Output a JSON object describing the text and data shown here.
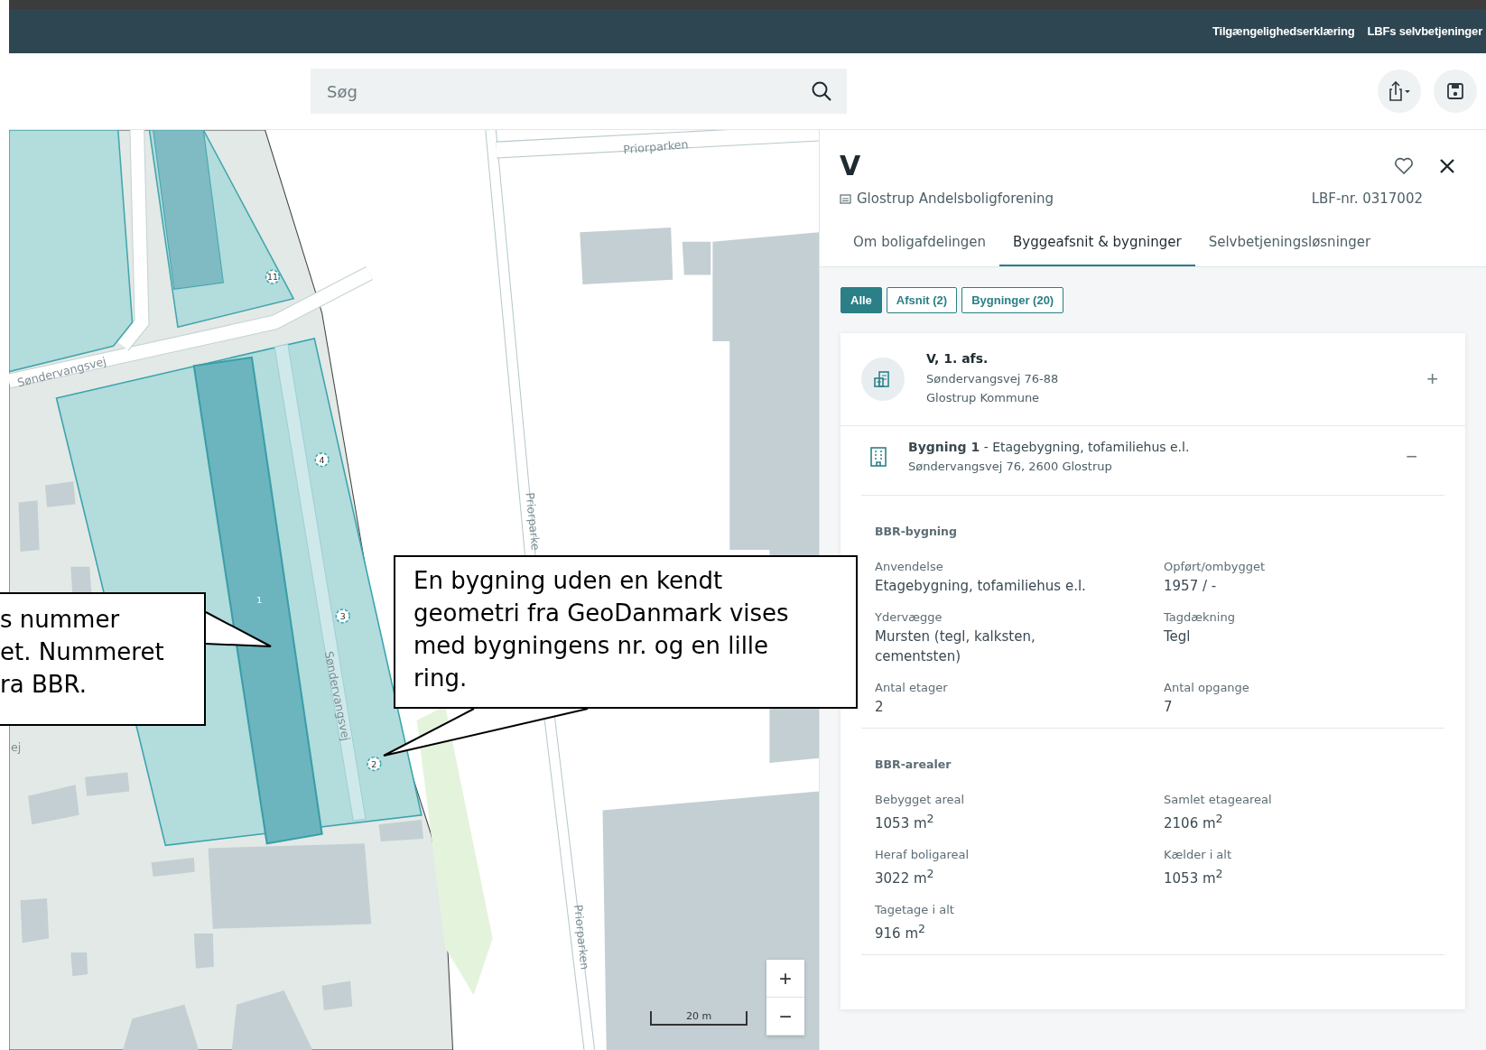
{
  "top_links": [
    "Tilgængelighedserklæring",
    "LBFs selvbetjeninger"
  ],
  "search": {
    "placeholder": "Søg"
  },
  "map": {
    "street_labels": [
      "Søndervangsvej",
      "Priorparken",
      "Priorparke",
      "Søndervangsvej",
      "Priorparken",
      "ej"
    ],
    "building_numbers": [
      "11",
      "4",
      "1",
      "3",
      "2"
    ],
    "scale": "20 m",
    "zoom_in": "+",
    "zoom_out": "−"
  },
  "callouts": [
    {
      "lines": [
        "s nummer",
        "et. Nummeret",
        "ra BBR."
      ]
    },
    {
      "lines": [
        "En bygning uden en kendt",
        "geometri fra GeoDanmark vises",
        "med bygningens nr. og en lille",
        "ring."
      ]
    }
  ],
  "panel": {
    "title": "V",
    "association": "Glostrup Andelsboligforening",
    "lbf_number": "LBF-nr. 0317002",
    "tabs": [
      {
        "label": "Om boligafdelingen",
        "selected": false
      },
      {
        "label": "Byggeafsnit & bygninger",
        "selected": true
      },
      {
        "label": "Selvbetjeningsløsninger",
        "selected": false
      }
    ],
    "filters": [
      {
        "label": "Alle",
        "selected": true
      },
      {
        "label": "Afsnit (2)",
        "selected": false
      },
      {
        "label": "Bygninger (20)",
        "selected": false
      }
    ],
    "section": {
      "title": "V, 1. afs.",
      "address": "Søndervangsvej 76-88",
      "municipality": "Glostrup Kommune",
      "toggle": "+"
    },
    "building": {
      "title": "**Bygning 1** - Etagebygning, tofamiliehus e.l.",
      "address": "Søndervangsvej 76, 2600 Glostrup",
      "toggle": "−",
      "groups": [
        {
          "heading": "BBR-bygning",
          "fields": [
            {
              "label": "Anvendelse",
              "value": "Etagebygning, tofamiliehus e.l."
            },
            {
              "label": "Opført/ombygget",
              "value": "1957 / -"
            },
            {
              "label": "Ydervægge",
              "value": "Mursten (tegl, kalksten, cementsten)"
            },
            {
              "label": "Tagdækning",
              "value": "Tegl"
            },
            {
              "label": "Antal etager",
              "value": "2"
            },
            {
              "label": "Antal opgange",
              "value": "7"
            }
          ]
        },
        {
          "heading": "BBR-arealer",
          "fields": [
            {
              "label": "Bebygget areal",
              "value": "1053 m$^{2}$"
            },
            {
              "label": "Samlet etageareal",
              "value": "2106 m$^{2}$"
            },
            {
              "label": "Heraf boligareal",
              "value": "3022 m$^{2}$"
            },
            {
              "label": "Kælder i alt",
              "value": "1053 m$^{2}$"
            },
            {
              "label": "Tagetage i alt",
              "value": "916 m$^{2}$"
            }
          ]
        }
      ]
    }
  }
}
